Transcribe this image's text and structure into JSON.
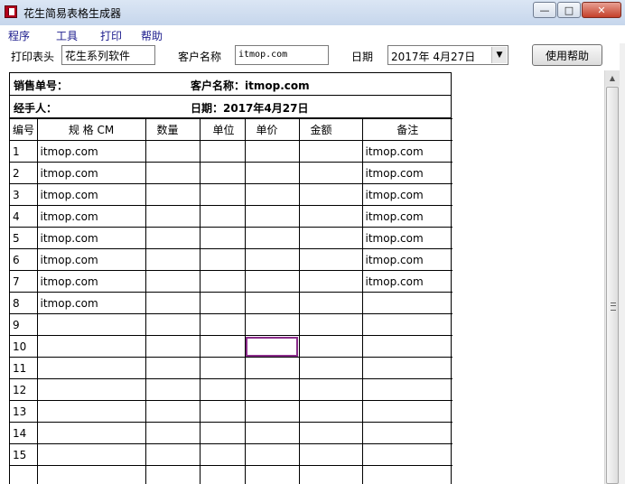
{
  "window": {
    "title": "花生简易表格生成器",
    "min_glyph": "—",
    "max_glyph": "□",
    "close_glyph": "✕"
  },
  "menu": [
    "程序",
    "工具",
    "打印",
    "帮助"
  ],
  "toolbar": {
    "header_label": "打印表头",
    "header_value": "花生系列软件",
    "customer_label": "客户名称",
    "customer_value": "itmop.com",
    "date_label": "日期",
    "date_value": "2017年  4月27日",
    "help_button": "使用帮助"
  },
  "sheet": {
    "sales_no_label": "销售单号：",
    "customer_line": "客户名称：itmop.com",
    "handler_label": "经手人：",
    "date_line": "日期：2017年4月27日",
    "columns": [
      "编号",
      "规  格 CM",
      "数量",
      "单位",
      "单价",
      "金额",
      "备注"
    ],
    "rows": [
      {
        "no": "1",
        "spec": "itmop.com",
        "qty": "",
        "unit": "",
        "price": "",
        "amount": "",
        "note": "itmop.com"
      },
      {
        "no": "2",
        "spec": "itmop.com",
        "qty": "",
        "unit": "",
        "price": "",
        "amount": "",
        "note": "itmop.com"
      },
      {
        "no": "3",
        "spec": "itmop.com",
        "qty": "",
        "unit": "",
        "price": "",
        "amount": "",
        "note": "itmop.com"
      },
      {
        "no": "4",
        "spec": "itmop.com",
        "qty": "",
        "unit": "",
        "price": "",
        "amount": "",
        "note": "itmop.com"
      },
      {
        "no": "5",
        "spec": "itmop.com",
        "qty": "",
        "unit": "",
        "price": "",
        "amount": "",
        "note": "itmop.com"
      },
      {
        "no": "6",
        "spec": "itmop.com",
        "qty": "",
        "unit": "",
        "price": "",
        "amount": "",
        "note": "itmop.com"
      },
      {
        "no": "7",
        "spec": "itmop.com",
        "qty": "",
        "unit": "",
        "price": "",
        "amount": "",
        "note": "itmop.com"
      },
      {
        "no": "8",
        "spec": "itmop.com",
        "qty": "",
        "unit": "",
        "price": "",
        "amount": "",
        "note": ""
      },
      {
        "no": "9",
        "spec": "",
        "qty": "",
        "unit": "",
        "price": "",
        "amount": "",
        "note": ""
      },
      {
        "no": "10",
        "spec": "",
        "qty": "",
        "unit": "",
        "price": "",
        "amount": "",
        "note": ""
      },
      {
        "no": "11",
        "spec": "",
        "qty": "",
        "unit": "",
        "price": "",
        "amount": "",
        "note": ""
      },
      {
        "no": "12",
        "spec": "",
        "qty": "",
        "unit": "",
        "price": "",
        "amount": "",
        "note": ""
      },
      {
        "no": "13",
        "spec": "",
        "qty": "",
        "unit": "",
        "price": "",
        "amount": "",
        "note": ""
      },
      {
        "no": "14",
        "spec": "",
        "qty": "",
        "unit": "",
        "price": "",
        "amount": "",
        "note": ""
      },
      {
        "no": "15",
        "spec": "",
        "qty": "",
        "unit": "",
        "price": "",
        "amount": "",
        "note": ""
      },
      {
        "no": "",
        "spec": "",
        "qty": "",
        "unit": "",
        "price": "",
        "amount": "",
        "note": ""
      }
    ]
  },
  "colors": {
    "title_bar": "#c6d6ec",
    "menu_text": "#1a1a8c",
    "selected_cell_border": "#8a2c8a"
  }
}
